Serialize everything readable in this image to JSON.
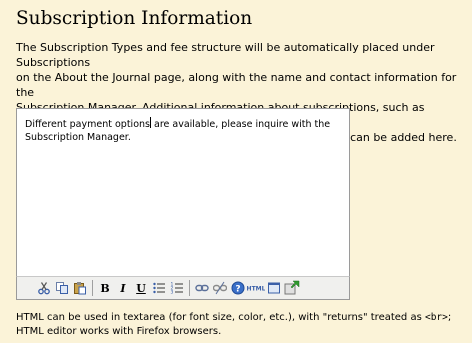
{
  "header": {
    "title": "Subscription Information"
  },
  "intro": {
    "text": "The Subscription Types and fee structure will be automatically placed under Subscriptions\non the About the Journal page, along with the name and contact information for the\nSubscription Manager. Additional information about subscriptions, such as methods of\npayment or support for subscribers in developing countries, can be added here."
  },
  "editor": {
    "text_before_caret": "Different payment options",
    "text_after_caret": " are available, please inquire with the\nSubscription Manager."
  },
  "toolbar": {
    "items": [
      {
        "icon": "cut-icon",
        "glyph": "✂"
      },
      {
        "icon": "copy-icon",
        "glyph": "⧉"
      },
      {
        "icon": "paste-icon",
        "glyph": "📋"
      },
      {
        "icon": "bold-icon",
        "glyph": "B"
      },
      {
        "icon": "italic-icon",
        "glyph": "I"
      },
      {
        "icon": "underline-icon",
        "glyph": "U"
      },
      {
        "icon": "bullet-list-icon",
        "glyph": "☰"
      },
      {
        "icon": "numbered-list-icon",
        "glyph": "≡"
      },
      {
        "icon": "link-icon",
        "glyph": "∞"
      },
      {
        "icon": "unlink-icon",
        "glyph": "⚯"
      },
      {
        "icon": "help-icon",
        "glyph": "?"
      },
      {
        "icon": "html-icon",
        "glyph": "HTML"
      },
      {
        "icon": "fullscreen-icon",
        "glyph": "▣"
      },
      {
        "icon": "insert-image-icon",
        "glyph": "⬇"
      }
    ],
    "accent_color": "#3a5fa8"
  },
  "help": {
    "text_before_code": "HTML can be used in textarea (for font size, color, etc.), with \"returns\" treated as ",
    "code": "<br>",
    "text_after_code": ";\nHTML editor works with Firefox browsers."
  }
}
